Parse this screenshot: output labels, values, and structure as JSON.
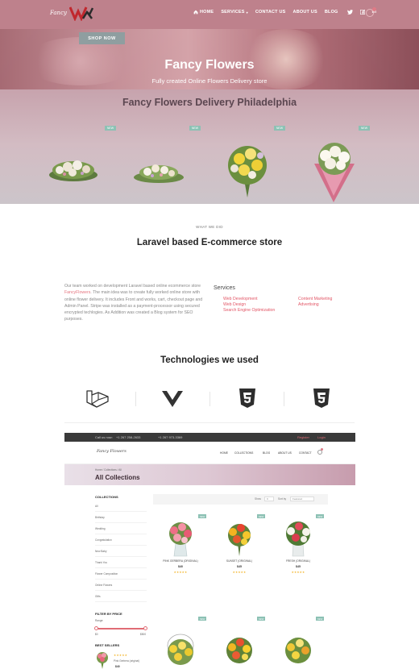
{
  "header": {
    "logo_text": "Fancy",
    "nav": [
      {
        "label": "HOME",
        "icon": "home-icon"
      },
      {
        "label": "SERVICES"
      },
      {
        "label": "CONTACT US"
      },
      {
        "label": "ABOUT US"
      },
      {
        "label": "BLOG"
      }
    ],
    "social": [
      "twitter-icon",
      "facebook-icon",
      "linkedin-icon"
    ]
  },
  "hero": {
    "shop_now": "SHOP NOW",
    "title": "Fancy Flowers",
    "subtitle": "Fully created Online Flowers Delivery store",
    "delivery_title": "Fancy Flowers Delivery Philadelphia",
    "cards": [
      {
        "badge": "NEW"
      },
      {
        "badge": "NEW"
      },
      {
        "badge": "NEW"
      },
      {
        "badge": "NEW"
      }
    ]
  },
  "about": {
    "eyebrow": "WHAT WE DID",
    "title": "Laravel based E-commerce store",
    "desc_1": "Our team worked on development Laravel based online ecommerce store ",
    "desc_link": "FancyFlowers",
    "desc_2": ". The main idea was to create fully worked online store with online flower delivery. It includes Front and works, cart, checkout page and Admin Panel. Stripe was installed as a payment-processor using secured encrypted techlogies. As Addition was created a Blog system for SEO purposes.",
    "services_title": "Services",
    "services": [
      "Web Development",
      "Web Design",
      "Search Engine Optimization",
      "Content Marketing",
      "Advertising"
    ]
  },
  "tech": {
    "title": "Technologies we used",
    "logos": [
      "laravel-icon",
      "vue-icon",
      "html5-icon",
      "css3-icon"
    ]
  },
  "colors": {
    "accent": "#e25666",
    "hero_pink": "#be818c",
    "badge_green": "#8cc1b4",
    "star": "#f2b01e"
  },
  "shot": {
    "topbar": {
      "call": "Call us now:",
      "phone1": "+1 267 258-2633",
      "phone2": "+1 267 973-3369",
      "register": "Register",
      "login": "Login"
    },
    "logo": "Fancy Flowers",
    "nav": [
      "HOME",
      "COLLECTIONS",
      "BLOG",
      "ABOUT US",
      "CONTACT"
    ],
    "breadcrumb": "Home / Collections / All",
    "page_title": "All Collections",
    "collections_head": "COLLECTIONS",
    "collections": [
      "All",
      "Birthday",
      "Wedding",
      "Congratulation",
      "New Baby",
      "Thank You",
      "Flower Composition",
      "Online Flowers",
      "Gifts"
    ],
    "filter_head": "FILTER BY PRICE",
    "range_label": "Range:",
    "range_min": "$0",
    "range_max": "$500",
    "best_head": "BEST SELLERS",
    "best": {
      "stars": "★★★★★",
      "name": "Pink Gerbera (original)",
      "price": "$40"
    },
    "toolbar": {
      "show": "Show",
      "show_val": "9",
      "sort": "Sort by",
      "sort_val": "Featured"
    },
    "products": [
      {
        "name": "PINK GERBERA (ORIGINAL)",
        "price": "$40",
        "stars": "★★★★★",
        "badge": "NEW"
      },
      {
        "name": "SUNSET (ORIGINAL)",
        "price": "$45",
        "stars": "★★★★★",
        "badge": "NEW"
      },
      {
        "name": "FRESH (ORIGINAL)",
        "price": "$45",
        "stars": "★★★★★",
        "badge": "NEW"
      },
      {
        "name": "",
        "price": "",
        "stars": "",
        "badge": "NEW"
      },
      {
        "name": "",
        "price": "",
        "stars": "",
        "badge": "NEW"
      },
      {
        "name": "",
        "price": "",
        "stars": "",
        "badge": "NEW"
      }
    ]
  }
}
